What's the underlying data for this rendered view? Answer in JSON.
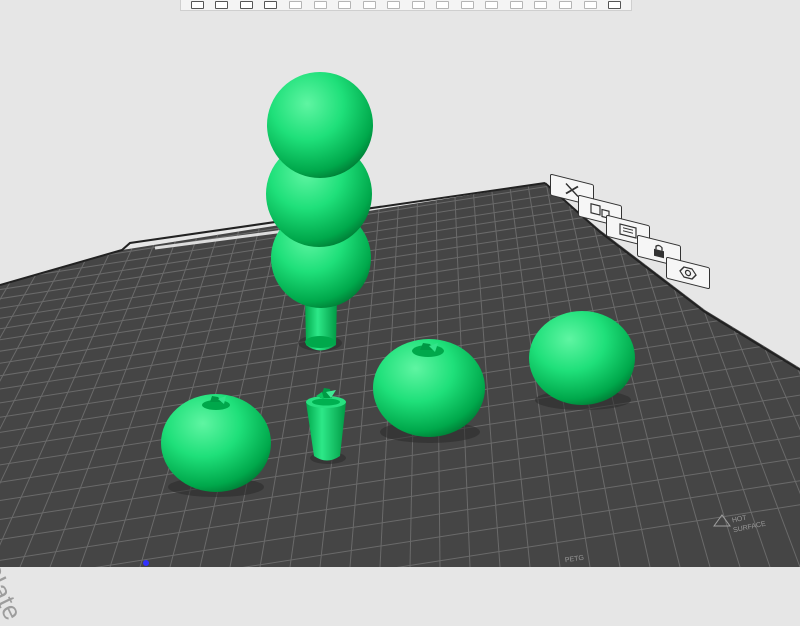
{
  "toolbar": {
    "icons": [
      {
        "name": "add-object-icon",
        "style": "normal"
      },
      {
        "name": "add-plate-icon",
        "style": "normal"
      },
      {
        "name": "orient-icon",
        "style": "normal"
      },
      {
        "name": "arrange-icon",
        "style": "normal"
      },
      {
        "name": "split-objects-icon",
        "style": "faint"
      },
      {
        "name": "split-parts-icon",
        "style": "faint"
      },
      {
        "name": "variable-layer-icon",
        "style": "faint"
      },
      {
        "name": "move-icon",
        "style": "faint"
      },
      {
        "name": "rotate-icon",
        "style": "faint"
      },
      {
        "name": "scale-icon",
        "style": "faint"
      },
      {
        "name": "lay-on-face-icon",
        "style": "faint"
      },
      {
        "name": "cut-icon",
        "style": "faint"
      },
      {
        "name": "mesh-boolean-icon",
        "style": "faint"
      },
      {
        "name": "support-paint-icon",
        "style": "faint"
      },
      {
        "name": "seam-paint-icon",
        "style": "faint"
      },
      {
        "name": "color-paint-icon",
        "style": "faint"
      },
      {
        "name": "measure-icon",
        "style": "faint"
      },
      {
        "name": "assembly-view-icon",
        "style": "normal"
      }
    ]
  },
  "plate": {
    "name": "ured PEI Plate",
    "label_petg": "PETG",
    "label_hot_surface_1": "HOT",
    "label_hot_surface_2": "SURFACE"
  },
  "plate_buttons": [
    {
      "name": "delete-plate-button",
      "icon": "close-icon",
      "glyph": "✕"
    },
    {
      "name": "arrange-plate-button",
      "icon": "arrange-icon",
      "glyph": ""
    },
    {
      "name": "orient-plate-button",
      "icon": "orient-icon",
      "glyph": ""
    },
    {
      "name": "lock-plate-button",
      "icon": "lock-icon",
      "glyph": ""
    },
    {
      "name": "plate-settings-button",
      "icon": "gear-icon",
      "glyph": "⚙"
    }
  ],
  "colors": {
    "background": "#e6e6e6",
    "plate": "#454545",
    "plate_grid": "#6a6a6a",
    "model_green": "#00c853"
  }
}
